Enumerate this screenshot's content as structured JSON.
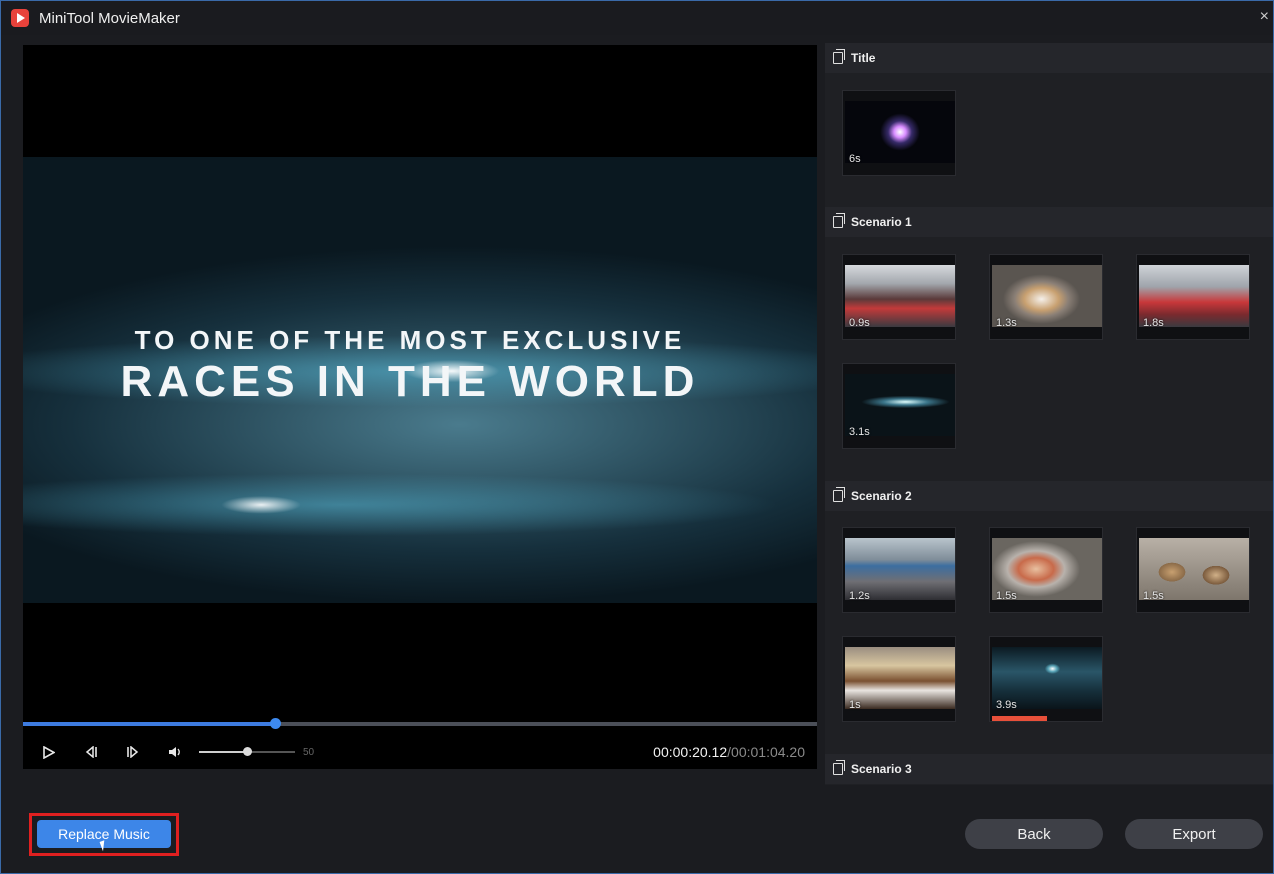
{
  "app": {
    "title": "MiniTool MovieMaker",
    "close_glyph": "×"
  },
  "video": {
    "line1": "TO ONE OF THE MOST EXCLUSIVE",
    "line2": "RACES IN THE WORLD"
  },
  "player": {
    "progress_fraction": 0.318,
    "volume_value": "50",
    "volume_fraction": 0.5,
    "current_time": "00:00:20.12",
    "total_time": "/00:01:04.20",
    "icons": {
      "play": "play-icon",
      "prev": "prev-frame-icon",
      "next": "next-frame-icon",
      "volume": "volume-icon"
    }
  },
  "sections": [
    {
      "title": "Title",
      "thumbs": [
        {
          "duration": "6s"
        }
      ]
    },
    {
      "title": "Scenario 1",
      "thumbs": [
        {
          "duration": "0.9s"
        },
        {
          "duration": "1.3s"
        },
        {
          "duration": "1.8s"
        },
        {
          "duration": "3.1s"
        }
      ]
    },
    {
      "title": "Scenario 2",
      "thumbs": [
        {
          "duration": "1.2s"
        },
        {
          "duration": "1.5s"
        },
        {
          "duration": "1.5s"
        },
        {
          "duration": "1s"
        },
        {
          "duration": "3.9s"
        }
      ]
    },
    {
      "title": "Scenario 3"
    }
  ],
  "buttons": {
    "replace_music": "Replace Music",
    "back": "Back",
    "export": "Export"
  },
  "colors": {
    "accent": "#3d86e8",
    "highlight": "#e02020",
    "active_bar": "#e8503a"
  }
}
